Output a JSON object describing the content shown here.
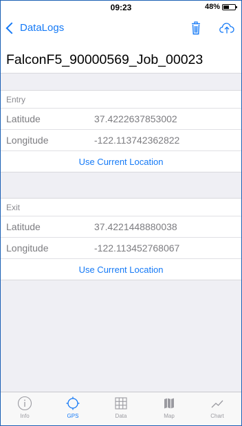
{
  "status_bar": {
    "time": "09:23",
    "battery_percent": "48%",
    "battery_level": 0.48
  },
  "nav": {
    "back_label": "DataLogs",
    "trash_icon": "trash-icon",
    "upload_icon": "cloud-upload-icon"
  },
  "title": "FalconF5_90000569_Job_00023",
  "entry": {
    "header": "Entry",
    "latitude_label": "Latitude",
    "latitude_value": "37.4222637853002",
    "longitude_label": "Longitude",
    "longitude_value": "-122.113742362822",
    "action_label": "Use Current Location"
  },
  "exit": {
    "header": "Exit",
    "latitude_label": "Latitude",
    "latitude_value": "37.4221448880038",
    "longitude_label": "Longitude",
    "longitude_value": "-122.113452768067",
    "action_label": "Use Current Location"
  },
  "tabs": [
    {
      "label": "Info",
      "icon": "info-icon"
    },
    {
      "label": "GPS",
      "icon": "gps-icon",
      "active": true
    },
    {
      "label": "Data",
      "icon": "grid-icon"
    },
    {
      "label": "Map",
      "icon": "map-icon"
    },
    {
      "label": "Chart",
      "icon": "chart-icon"
    }
  ],
  "colors": {
    "accent": "#1479f6",
    "background": "#efeff4",
    "inactive_tab": "#9a9aa0",
    "secondary_text": "#7c7c80"
  }
}
